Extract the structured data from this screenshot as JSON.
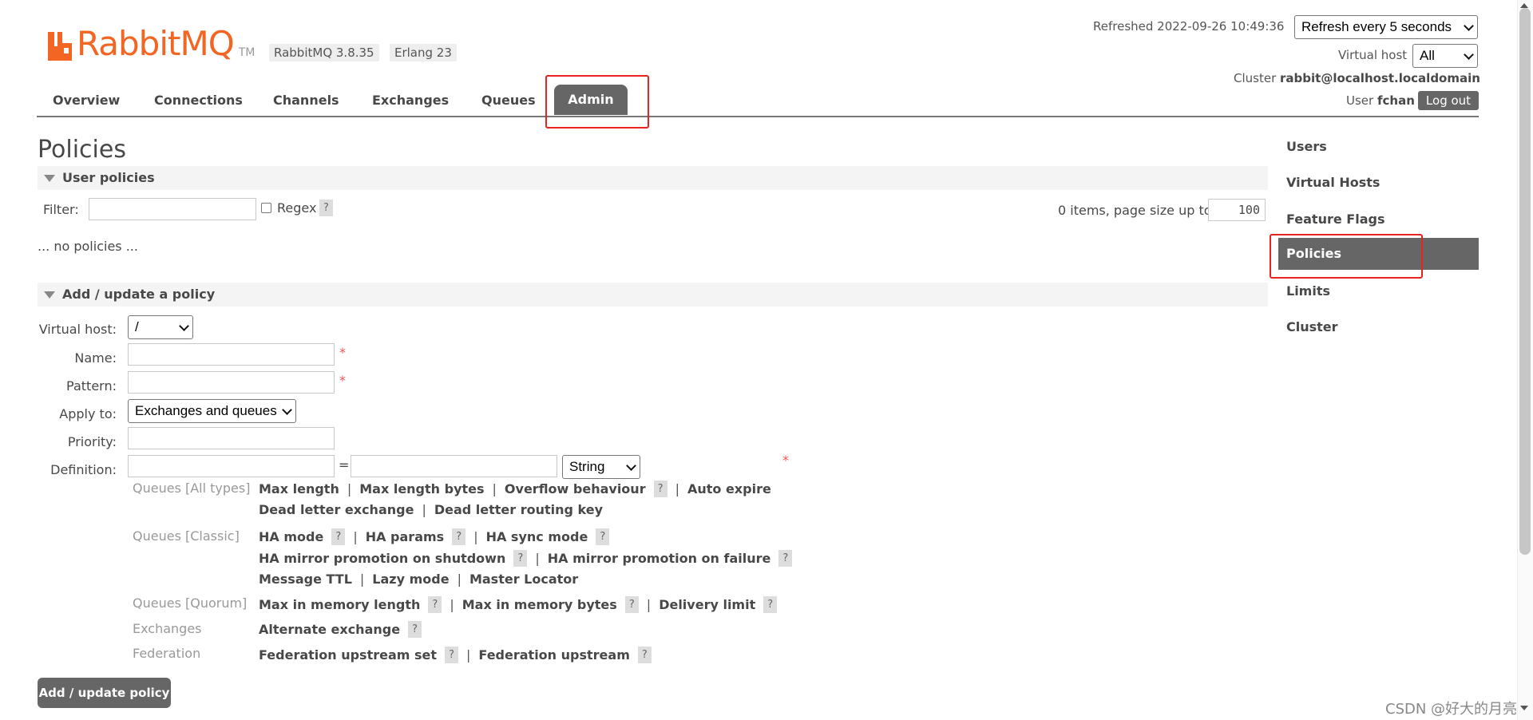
{
  "header": {
    "logo_rabbit": "RabbitMQ",
    "logo_tm": "TM",
    "version_badge": "RabbitMQ 3.8.35",
    "erlang_badge": "Erlang 23",
    "refreshed_label": "Refreshed 2022-09-26 10:49:36",
    "refresh_select": "Refresh every 5 seconds",
    "vhost_label": "Virtual host",
    "vhost_select": "All",
    "cluster_label": "Cluster",
    "cluster_name": "rabbit@localhost.localdomain",
    "user_label": "User",
    "user_name": "fchan",
    "logout": "Log out"
  },
  "nav": {
    "tabs": [
      "Overview",
      "Connections",
      "Channels",
      "Exchanges",
      "Queues",
      "Admin"
    ],
    "active": "Admin"
  },
  "page": {
    "title": "Policies",
    "user_policies": {
      "header": "User policies",
      "filter_label": "Filter:",
      "regex_label": "Regex",
      "help": "?",
      "items_text": "0 items, page size up to",
      "page_size": "100",
      "empty_text": "... no policies ..."
    },
    "form": {
      "header": "Add / update a policy",
      "vhost_label": "Virtual host:",
      "vhost_value": "/",
      "name_label": "Name:",
      "pattern_label": "Pattern:",
      "apply_label": "Apply to:",
      "apply_value": "Exchanges and queues",
      "priority_label": "Priority:",
      "definition_label": "Definition:",
      "equals": "=",
      "type_value": "String",
      "required": "*",
      "submit": "Add / update policy"
    },
    "definition_keys": {
      "queues_all": "Queues [All types]",
      "max_length": "Max length",
      "max_length_bytes": "Max length bytes",
      "overflow": "Overflow behaviour",
      "auto_expire": "Auto expire",
      "dlx": "Dead letter exchange",
      "dlrk": "Dead letter routing key",
      "queues_classic": "Queues [Classic]",
      "ha_mode": "HA mode",
      "ha_params": "HA params",
      "ha_sync": "HA sync mode",
      "ha_promo_shutdown": "HA mirror promotion on shutdown",
      "ha_promo_failure": "HA mirror promotion on failure",
      "msg_ttl": "Message TTL",
      "lazy": "Lazy mode",
      "master_locator": "Master Locator",
      "queues_quorum": "Queues [Quorum]",
      "max_mem_len": "Max in memory length",
      "max_mem_bytes": "Max in memory bytes",
      "delivery_limit": "Delivery limit",
      "exchanges": "Exchanges",
      "alt_exchange": "Alternate exchange",
      "federation": "Federation",
      "fed_upstream_set": "Federation upstream set",
      "fed_upstream": "Federation upstream",
      "sep": "|",
      "q": "?"
    }
  },
  "sidebar": {
    "items": [
      "Users",
      "Virtual Hosts",
      "Feature Flags",
      "Policies",
      "Limits",
      "Cluster"
    ],
    "active": "Policies"
  },
  "watermark": "CSDN @好大的月亮",
  "colors": {
    "brand": "#f26522",
    "active_bg": "#666666",
    "highlight": "#e8231f"
  }
}
